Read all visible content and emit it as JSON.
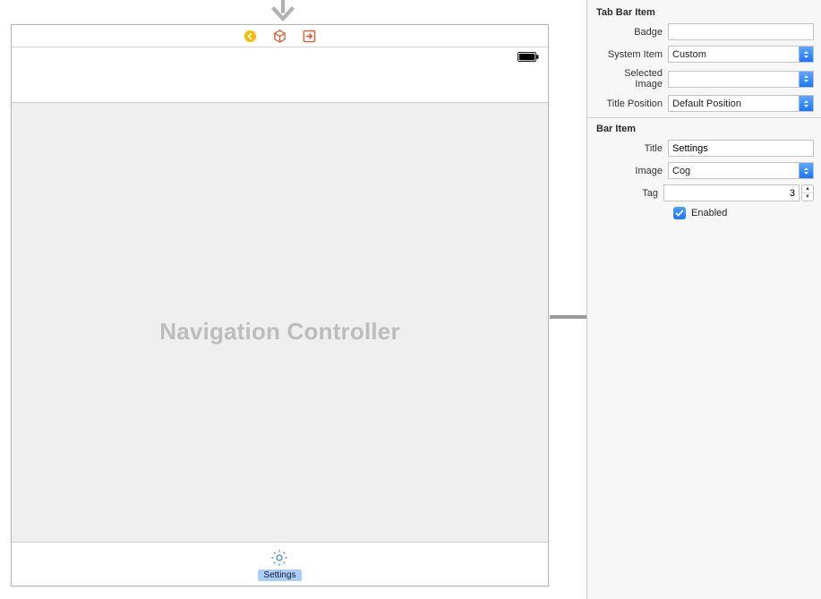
{
  "canvas": {
    "content_label": "Navigation Controller",
    "tab_item_title": "Settings"
  },
  "inspector": {
    "tab_bar_item": {
      "section_title": "Tab Bar Item",
      "badge_label": "Badge",
      "badge_value": "",
      "system_item_label": "System Item",
      "system_item_value": "Custom",
      "selected_image_label": "Selected Image",
      "selected_image_value": "",
      "title_position_label": "Title Position",
      "title_position_value": "Default Position"
    },
    "bar_item": {
      "section_title": "Bar Item",
      "title_label": "Title",
      "title_value": "Settings",
      "image_label": "Image",
      "image_value": "Cog",
      "tag_label": "Tag",
      "tag_value": "3",
      "enabled_label": "Enabled",
      "enabled_checked": true
    }
  }
}
